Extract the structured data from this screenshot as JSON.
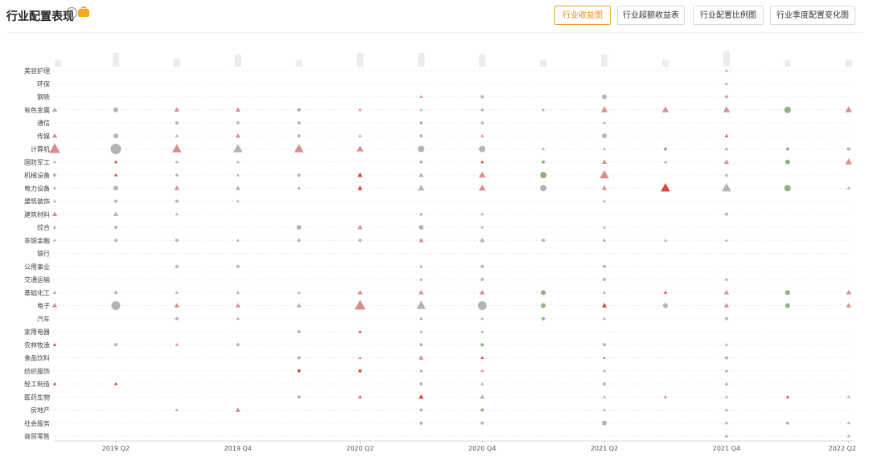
{
  "header": {
    "title": "行业配置表现",
    "buttons": [
      {
        "label": "行业收益图",
        "active": true
      },
      {
        "label": "行业超额收益表",
        "active": false
      },
      {
        "label": "行业配置比例图",
        "active": false
      },
      {
        "label": "行业季度配置变化图",
        "active": false
      }
    ]
  },
  "chart_data": {
    "type": "scatter",
    "x_ticks": [
      "2019 Q2",
      "2019 Q4",
      "2020 Q2",
      "2020 Q4",
      "2021 Q2",
      "2021 Q4",
      "2022 Q2"
    ],
    "periods": [
      "2019Q1",
      "2019Q2",
      "2019Q3",
      "2019Q4",
      "2020Q1",
      "2020Q2",
      "2020Q3",
      "2020Q4",
      "2021Q1",
      "2021Q2",
      "2021Q3",
      "2021Q4",
      "2022Q1",
      "2022Q2"
    ],
    "categories": [
      "美容护理",
      "环保",
      "钢铁",
      "有色金属",
      "通信",
      "传媒",
      "计算机",
      "国防军工",
      "机械设备",
      "电力设备",
      "建筑装饰",
      "建筑材料",
      "综合",
      "非银金融",
      "银行",
      "公用事业",
      "交通运输",
      "基础化工",
      "电子",
      "汽车",
      "家用电器",
      "农林牧渔",
      "食品饮料",
      "纺织服饰",
      "轻工制造",
      "医药生物",
      "房地产",
      "社会服务",
      "商贸零售"
    ],
    "top_bar_values": [
      0.2,
      0.6,
      0.3,
      0.5,
      0.2,
      0.6,
      0.6,
      0.5,
      0.2,
      0.5,
      0.2,
      0.7,
      0.2,
      0.2
    ],
    "points": [
      [
        "美容护理",
        11,
        "t",
        1,
        "g"
      ],
      [
        "环保",
        11,
        "t",
        1,
        "g"
      ],
      [
        "钢铁",
        6,
        "t",
        1,
        "r"
      ],
      [
        "钢铁",
        7,
        "c",
        1,
        "g"
      ],
      [
        "钢铁",
        9,
        "c",
        2,
        "g"
      ],
      [
        "钢铁",
        11,
        "c",
        1,
        "g"
      ],
      [
        "有色金属",
        0,
        "t",
        2,
        "g"
      ],
      [
        "有色金属",
        1,
        "c",
        2,
        "g"
      ],
      [
        "有色金属",
        2,
        "t",
        2,
        "r"
      ],
      [
        "有色金属",
        3,
        "t",
        2,
        "r"
      ],
      [
        "有色金属",
        4,
        "c",
        1,
        "G"
      ],
      [
        "有色金属",
        5,
        "t",
        1,
        "r"
      ],
      [
        "有色金属",
        6,
        "t",
        1,
        "g"
      ],
      [
        "有色金属",
        7,
        "t",
        1,
        "r"
      ],
      [
        "有色金属",
        8,
        "t",
        1,
        "g"
      ],
      [
        "有色金属",
        9,
        "t",
        3,
        "r"
      ],
      [
        "有色金属",
        10,
        "t",
        3,
        "r"
      ],
      [
        "有色金属",
        11,
        "t",
        3,
        "r"
      ],
      [
        "有色金属",
        12,
        "c",
        3,
        "G"
      ],
      [
        "有色金属",
        13,
        "t",
        3,
        "r"
      ],
      [
        "通信",
        2,
        "c",
        1,
        "g"
      ],
      [
        "通信",
        3,
        "c",
        1,
        "g"
      ],
      [
        "通信",
        4,
        "c",
        1,
        "g"
      ],
      [
        "通信",
        6,
        "c",
        1,
        "g"
      ],
      [
        "通信",
        7,
        "t",
        1,
        "r"
      ],
      [
        "通信",
        9,
        "t",
        1,
        "g"
      ],
      [
        "传媒",
        0,
        "t",
        2,
        "r"
      ],
      [
        "传媒",
        1,
        "c",
        2,
        "g"
      ],
      [
        "传媒",
        2,
        "t",
        1,
        "g"
      ],
      [
        "传媒",
        3,
        "t",
        2,
        "r"
      ],
      [
        "传媒",
        4,
        "c",
        1,
        "g"
      ],
      [
        "传媒",
        5,
        "t",
        1,
        "g"
      ],
      [
        "传媒",
        6,
        "c",
        1,
        "g"
      ],
      [
        "传媒",
        7,
        "t",
        1,
        "r"
      ],
      [
        "传媒",
        9,
        "c",
        2,
        "g"
      ],
      [
        "传媒",
        11,
        "t",
        1,
        "R"
      ],
      [
        "计算机",
        0,
        "t",
        5,
        "r"
      ],
      [
        "计算机",
        1,
        "c",
        5,
        "g"
      ],
      [
        "计算机",
        2,
        "t",
        4,
        "r"
      ],
      [
        "计算机",
        3,
        "t",
        4,
        "g"
      ],
      [
        "计算机",
        4,
        "t",
        4,
        "r"
      ],
      [
        "计算机",
        5,
        "t",
        3,
        "r"
      ],
      [
        "计算机",
        6,
        "c",
        3,
        "g"
      ],
      [
        "计算机",
        7,
        "c",
        3,
        "g"
      ],
      [
        "计算机",
        8,
        "t",
        1,
        "g"
      ],
      [
        "计算机",
        9,
        "t",
        1,
        "g"
      ],
      [
        "计算机",
        10,
        "c",
        1,
        "G"
      ],
      [
        "计算机",
        11,
        "t",
        1,
        "r"
      ],
      [
        "计算机",
        12,
        "c",
        1,
        "G"
      ],
      [
        "计算机",
        13,
        "c",
        1,
        "g"
      ],
      [
        "国防军工",
        0,
        "t",
        1,
        "g"
      ],
      [
        "国防军工",
        1,
        "t",
        1,
        "R"
      ],
      [
        "国防军工",
        2,
        "t",
        1,
        "g"
      ],
      [
        "国防军工",
        3,
        "t",
        1,
        "g"
      ],
      [
        "国防军工",
        6,
        "c",
        1,
        "g"
      ],
      [
        "国防军工",
        7,
        "t",
        1,
        "R"
      ],
      [
        "国防军工",
        8,
        "c",
        1,
        "G"
      ],
      [
        "国防军工",
        9,
        "t",
        2,
        "r"
      ],
      [
        "国防军工",
        10,
        "t",
        1,
        "g"
      ],
      [
        "国防军工",
        11,
        "t",
        2,
        "r"
      ],
      [
        "国防军工",
        12,
        "c",
        2,
        "G"
      ],
      [
        "国防军工",
        13,
        "t",
        3,
        "r"
      ],
      [
        "机械设备",
        0,
        "c",
        1,
        "g"
      ],
      [
        "机械设备",
        1,
        "t",
        1,
        "R"
      ],
      [
        "机械设备",
        2,
        "t",
        1,
        "r"
      ],
      [
        "机械设备",
        3,
        "t",
        1,
        "g"
      ],
      [
        "机械设备",
        4,
        "c",
        1,
        "g"
      ],
      [
        "机械设备",
        5,
        "t",
        2,
        "R"
      ],
      [
        "机械设备",
        6,
        "t",
        2,
        "g"
      ],
      [
        "机械设备",
        7,
        "t",
        3,
        "r"
      ],
      [
        "机械设备",
        8,
        "c",
        3,
        "G"
      ],
      [
        "机械设备",
        9,
        "t",
        4,
        "r"
      ],
      [
        "机械设备",
        11,
        "t",
        1,
        "r"
      ],
      [
        "电力设备",
        0,
        "t",
        1,
        "r"
      ],
      [
        "电力设备",
        1,
        "c",
        2,
        "g"
      ],
      [
        "电力设备",
        2,
        "t",
        2,
        "r"
      ],
      [
        "电力设备",
        3,
        "t",
        2,
        "g"
      ],
      [
        "电力设备",
        4,
        "t",
        1,
        "r"
      ],
      [
        "电力设备",
        5,
        "t",
        2,
        "R"
      ],
      [
        "电力设备",
        6,
        "t",
        3,
        "g"
      ],
      [
        "电力设备",
        7,
        "t",
        3,
        "r"
      ],
      [
        "电力设备",
        8,
        "c",
        3,
        "g"
      ],
      [
        "电力设备",
        9,
        "t",
        2,
        "r"
      ],
      [
        "电力设备",
        10,
        "t",
        4,
        "R"
      ],
      [
        "电力设备",
        11,
        "t",
        4,
        "g"
      ],
      [
        "电力设备",
        12,
        "c",
        3,
        "G"
      ],
      [
        "电力设备",
        13,
        "t",
        1,
        "g"
      ],
      [
        "建筑装饰",
        0,
        "t",
        1,
        "g"
      ],
      [
        "建筑装饰",
        1,
        "c",
        1,
        "g"
      ],
      [
        "建筑装饰",
        2,
        "c",
        1,
        "g"
      ],
      [
        "建筑装饰",
        3,
        "t",
        1,
        "g"
      ],
      [
        "建筑装饰",
        9,
        "t",
        1,
        "g"
      ],
      [
        "建筑材料",
        0,
        "t",
        2,
        "r"
      ],
      [
        "建筑材料",
        1,
        "t",
        2,
        "g"
      ],
      [
        "建筑材料",
        2,
        "t",
        1,
        "g"
      ],
      [
        "建筑材料",
        6,
        "t",
        1,
        "r"
      ],
      [
        "建筑材料",
        7,
        "t",
        1,
        "g"
      ],
      [
        "建筑材料",
        11,
        "c",
        1,
        "g"
      ],
      [
        "综合",
        0,
        "t",
        1,
        "r"
      ],
      [
        "综合",
        1,
        "c",
        1,
        "g"
      ],
      [
        "综合",
        4,
        "c",
        2,
        "g"
      ],
      [
        "综合",
        5,
        "t",
        2,
        "r"
      ],
      [
        "综合",
        6,
        "c",
        2,
        "g"
      ],
      [
        "综合",
        7,
        "t",
        1,
        "g"
      ],
      [
        "综合",
        9,
        "t",
        1,
        "g"
      ],
      [
        "非银金融",
        0,
        "t",
        1,
        "g"
      ],
      [
        "非银金融",
        1,
        "c",
        1,
        "g"
      ],
      [
        "非银金融",
        2,
        "c",
        1,
        "g"
      ],
      [
        "非银金融",
        3,
        "t",
        1,
        "g"
      ],
      [
        "非银金融",
        4,
        "c",
        1,
        "g"
      ],
      [
        "非银金融",
        5,
        "c",
        1,
        "g"
      ],
      [
        "非银金融",
        6,
        "t",
        2,
        "r"
      ],
      [
        "非银金融",
        7,
        "t",
        2,
        "g"
      ],
      [
        "非银金融",
        8,
        "c",
        1,
        "g"
      ],
      [
        "非银金融",
        9,
        "t",
        1,
        "r"
      ],
      [
        "非银金融",
        10,
        "t",
        1,
        "g"
      ],
      [
        "非银金融",
        11,
        "t",
        1,
        "g"
      ],
      [
        "公用事业",
        2,
        "c",
        1,
        "g"
      ],
      [
        "公用事业",
        3,
        "c",
        1,
        "g"
      ],
      [
        "公用事业",
        6,
        "t",
        1,
        "r"
      ],
      [
        "公用事业",
        7,
        "c",
        1,
        "g"
      ],
      [
        "公用事业",
        9,
        "c",
        1,
        "g"
      ],
      [
        "交通运输",
        6,
        "t",
        1,
        "r"
      ],
      [
        "交通运输",
        7,
        "c",
        1,
        "g"
      ],
      [
        "交通运输",
        9,
        "c",
        1,
        "g"
      ],
      [
        "交通运输",
        11,
        "t",
        1,
        "r"
      ],
      [
        "基础化工",
        0,
        "t",
        1,
        "r"
      ],
      [
        "基础化工",
        1,
        "c",
        1,
        "g"
      ],
      [
        "基础化工",
        2,
        "t",
        1,
        "g"
      ],
      [
        "基础化工",
        3,
        "t",
        1,
        "r"
      ],
      [
        "基础化工",
        4,
        "t",
        1,
        "g"
      ],
      [
        "基础化工",
        5,
        "t",
        2,
        "r"
      ],
      [
        "基础化工",
        6,
        "t",
        2,
        "r"
      ],
      [
        "基础化工",
        7,
        "t",
        2,
        "r"
      ],
      [
        "基础化工",
        8,
        "c",
        2,
        "G"
      ],
      [
        "基础化工",
        9,
        "t",
        1,
        "g"
      ],
      [
        "基础化工",
        10,
        "t",
        1,
        "R"
      ],
      [
        "基础化工",
        11,
        "t",
        2,
        "r"
      ],
      [
        "基础化工",
        12,
        "c",
        2,
        "G"
      ],
      [
        "基础化工",
        13,
        "t",
        2,
        "r"
      ],
      [
        "电子",
        0,
        "t",
        2,
        "r"
      ],
      [
        "电子",
        1,
        "c",
        4,
        "g"
      ],
      [
        "电子",
        2,
        "t",
        2,
        "r"
      ],
      [
        "电子",
        3,
        "t",
        2,
        "r"
      ],
      [
        "电子",
        4,
        "t",
        2,
        "g"
      ],
      [
        "电子",
        5,
        "t",
        5,
        "r"
      ],
      [
        "电子",
        6,
        "t",
        4,
        "g"
      ],
      [
        "电子",
        7,
        "c",
        4,
        "g"
      ],
      [
        "电子",
        8,
        "c",
        2,
        "G"
      ],
      [
        "电子",
        9,
        "t",
        2,
        "R"
      ],
      [
        "电子",
        10,
        "c",
        2,
        "g"
      ],
      [
        "电子",
        11,
        "t",
        2,
        "r"
      ],
      [
        "电子",
        12,
        "c",
        2,
        "G"
      ],
      [
        "电子",
        13,
        "t",
        2,
        "r"
      ],
      [
        "汽车",
        2,
        "c",
        1,
        "g"
      ],
      [
        "汽车",
        3,
        "t",
        1,
        "r"
      ],
      [
        "汽车",
        6,
        "t",
        1,
        "r"
      ],
      [
        "汽车",
        7,
        "t",
        1,
        "g"
      ],
      [
        "汽车",
        8,
        "c",
        1,
        "G"
      ],
      [
        "汽车",
        9,
        "t",
        1,
        "g"
      ],
      [
        "汽车",
        11,
        "c",
        1,
        "g"
      ],
      [
        "家用电器",
        4,
        "c",
        1,
        "g"
      ],
      [
        "家用电器",
        5,
        "t",
        1,
        "R"
      ],
      [
        "家用电器",
        6,
        "t",
        1,
        "g"
      ],
      [
        "家用电器",
        7,
        "t",
        1,
        "g"
      ],
      [
        "农林牧渔",
        0,
        "t",
        1,
        "R"
      ],
      [
        "农林牧渔",
        1,
        "c",
        1,
        "g"
      ],
      [
        "农林牧渔",
        2,
        "t",
        1,
        "r"
      ],
      [
        "农林牧渔",
        3,
        "c",
        1,
        "g"
      ],
      [
        "农林牧渔",
        6,
        "c",
        1,
        "g"
      ],
      [
        "农林牧渔",
        7,
        "c",
        1,
        "G"
      ],
      [
        "农林牧渔",
        9,
        "c",
        1,
        "g"
      ],
      [
        "农林牧渔",
        11,
        "t",
        1,
        "g"
      ],
      [
        "食品饮料",
        4,
        "c",
        1,
        "g"
      ],
      [
        "食品饮料",
        5,
        "t",
        1,
        "r"
      ],
      [
        "食品饮料",
        6,
        "t",
        2,
        "r"
      ],
      [
        "食品饮料",
        7,
        "t",
        1,
        "R"
      ],
      [
        "食品饮料",
        9,
        "t",
        1,
        "r"
      ],
      [
        "食品饮料",
        11,
        "c",
        1,
        "g"
      ],
      [
        "纺织服饰",
        4,
        "c",
        1,
        "R"
      ],
      [
        "纺织服饰",
        5,
        "c",
        1,
        "R"
      ],
      [
        "纺织服饰",
        6,
        "t",
        1,
        "r"
      ],
      [
        "纺织服饰",
        7,
        "t",
        1,
        "r"
      ],
      [
        "纺织服饰",
        9,
        "t",
        1,
        "g"
      ],
      [
        "纺织服饰",
        11,
        "t",
        1,
        "r"
      ],
      [
        "轻工制造",
        0,
        "t",
        1,
        "R"
      ],
      [
        "轻工制造",
        1,
        "t",
        1,
        "R"
      ],
      [
        "轻工制造",
        6,
        "c",
        1,
        "g"
      ],
      [
        "轻工制造",
        7,
        "t",
        1,
        "g"
      ],
      [
        "轻工制造",
        9,
        "c",
        1,
        "g"
      ],
      [
        "轻工制造",
        11,
        "t",
        1,
        "r"
      ],
      [
        "医药生物",
        4,
        "c",
        1,
        "g"
      ],
      [
        "医药生物",
        5,
        "t",
        1,
        "R"
      ],
      [
        "医药生物",
        6,
        "t",
        2,
        "R"
      ],
      [
        "医药生物",
        7,
        "t",
        2,
        "g"
      ],
      [
        "医药生物",
        9,
        "t",
        1,
        "g"
      ],
      [
        "医药生物",
        10,
        "t",
        1,
        "r"
      ],
      [
        "医药生物",
        11,
        "t",
        1,
        "g"
      ],
      [
        "医药生物",
        12,
        "t",
        1,
        "R"
      ],
      [
        "医药生物",
        13,
        "t",
        1,
        "g"
      ],
      [
        "房地产",
        2,
        "t",
        1,
        "g"
      ],
      [
        "房地产",
        3,
        "t",
        2,
        "r"
      ],
      [
        "房地产",
        6,
        "c",
        1,
        "g"
      ],
      [
        "房地产",
        7,
        "c",
        1,
        "G"
      ],
      [
        "房地产",
        9,
        "t",
        1,
        "g"
      ],
      [
        "房地产",
        11,
        "t",
        1,
        "r"
      ],
      [
        "社会服务",
        6,
        "c",
        1,
        "g"
      ],
      [
        "社会服务",
        7,
        "c",
        1,
        "g"
      ],
      [
        "社会服务",
        9,
        "c",
        2,
        "g"
      ],
      [
        "社会服务",
        11,
        "t",
        1,
        "r"
      ],
      [
        "社会服务",
        12,
        "c",
        1,
        "g"
      ],
      [
        "社会服务",
        13,
        "t",
        1,
        "g"
      ],
      [
        "商贸零售",
        11,
        "t",
        1,
        "r"
      ],
      [
        "商贸零售",
        13,
        "t",
        1,
        "g"
      ]
    ],
    "colors": {
      "r": "#d98f8f",
      "R": "#e0443c",
      "g": "#b4b4b4",
      "G": "#8fb27e"
    },
    "grid": true,
    "legend": "none"
  }
}
